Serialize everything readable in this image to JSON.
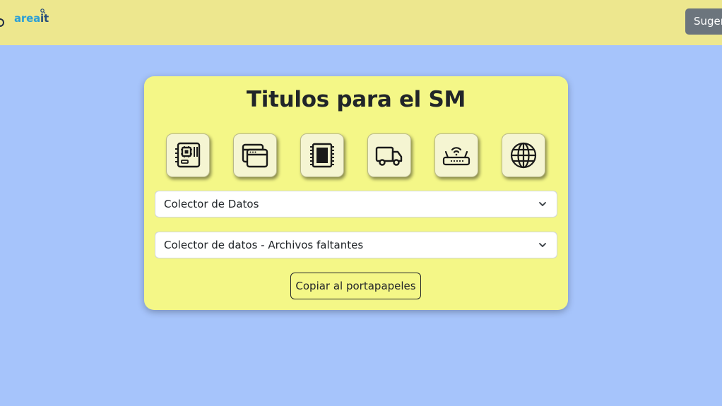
{
  "navbar": {
    "brand_part1": "area",
    "brand_part2": "it",
    "suggest_label": "Sugerencias"
  },
  "card": {
    "title": "Titulos para el SM",
    "icons": [
      {
        "name": "motherboard-icon"
      },
      {
        "name": "windows-icon"
      },
      {
        "name": "chip-icon"
      },
      {
        "name": "truck-icon"
      },
      {
        "name": "router-icon"
      },
      {
        "name": "globe-icon"
      }
    ],
    "select1_value": "Colector de Datos",
    "select2_value": "Colector de datos - Archivos faltantes",
    "copy_label": "Copiar al portapapeles"
  },
  "colors": {
    "background": "#a6c4fb",
    "navbar": "#ede78e",
    "card": "#f4f787",
    "icon_tile": "#f5f5d2",
    "suggest_button": "#6c757d"
  }
}
